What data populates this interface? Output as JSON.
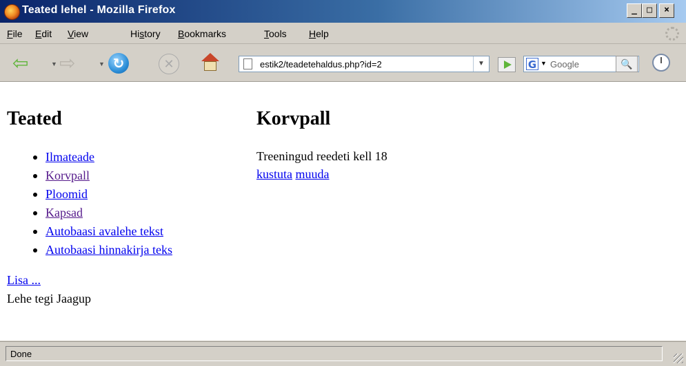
{
  "window": {
    "title": "Teated lehel - Mozilla Firefox",
    "controls": {
      "minimize": "_",
      "maximize": "□",
      "close": "×"
    }
  },
  "menubar": {
    "items": [
      {
        "label": "File",
        "accel": "F"
      },
      {
        "label": "Edit",
        "accel": "E"
      },
      {
        "label": "View",
        "accel": "V"
      },
      {
        "label": "History",
        "accel": "s"
      },
      {
        "label": "Bookmarks",
        "accel": "B"
      },
      {
        "label": "Tools",
        "accel": "T"
      },
      {
        "label": "Help",
        "accel": "H"
      }
    ]
  },
  "toolbar": {
    "url": "estik2/teadetehaldus.php?id=2",
    "search_placeholder": "Google",
    "icons": [
      "back-icon",
      "forward-icon",
      "reload-icon",
      "stop-icon",
      "home-icon",
      "go-icon",
      "google-icon",
      "search-icon",
      "history-icon"
    ]
  },
  "page": {
    "left_heading": "Teated",
    "nav": [
      {
        "label": "Ilmateade",
        "visited": false
      },
      {
        "label": "Korvpall",
        "visited": true
      },
      {
        "label": "Ploomid",
        "visited": false
      },
      {
        "label": "Kapsad",
        "visited": true
      },
      {
        "label": "Autobaasi avalehe tekst",
        "visited": false
      },
      {
        "label": "Autobaasi hinnakirja teks",
        "visited": false
      }
    ],
    "add_link": "Lisa ...",
    "footer": "Lehe tegi Jaagup",
    "right_heading": "Korvpall",
    "body_text": "Treeningud reedeti kell 18",
    "delete_link": "kustuta",
    "edit_link": "muuda"
  },
  "status": {
    "text": "Done"
  },
  "colors": {
    "link": "#0000ee",
    "visited_link": "#551a8b",
    "titlebar_start": "#0a246a",
    "titlebar_end": "#a6caf0"
  }
}
